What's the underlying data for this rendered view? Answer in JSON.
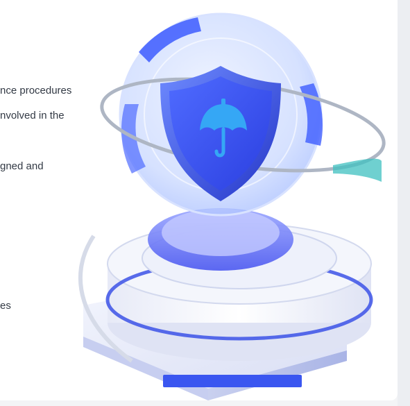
{
  "content": {
    "lines": [
      "nce procedures",
      "nvolved in the",
      "gned and",
      "es"
    ]
  },
  "illustration": {
    "icon": "shield-umbrella-icon",
    "colors": {
      "shield": "#3b55f2",
      "umbrella": "#35a7f5",
      "ring": "#aeb6c4",
      "accent_teal": "#3fc0c0",
      "platform": "#e6eaf7"
    }
  }
}
